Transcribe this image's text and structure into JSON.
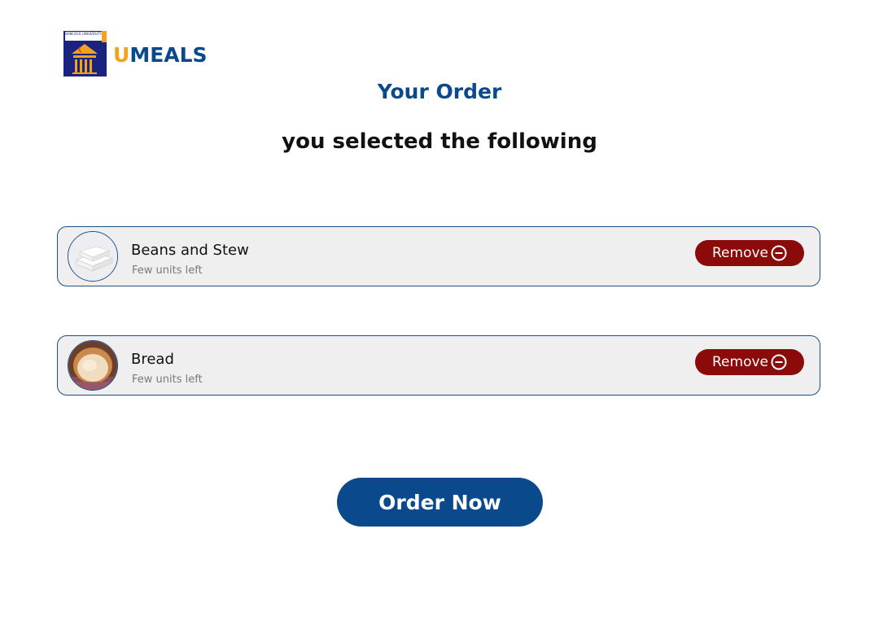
{
  "header": {
    "logo": {
      "icon": "babcock-university-crest-icon",
      "text": "BABCOCK UNIVERSITY"
    },
    "brand_prefix": "U",
    "brand_rest": "MEALS"
  },
  "page": {
    "title": "Your Order",
    "subtitle": "you selected the following"
  },
  "items": [
    {
      "name": "Beans and Stew",
      "stock": "Few units left",
      "image": "food-pack-image",
      "remove_label": "Remove",
      "remove_icon": "minus-circle-icon"
    },
    {
      "name": "Bread",
      "stock": "Few units left",
      "image": "bread-loaf-image",
      "remove_label": "Remove",
      "remove_icon": "minus-circle-icon"
    }
  ],
  "actions": {
    "order_label": "Order Now"
  },
  "colors": {
    "primary": "#0a4a8c",
    "accent": "#f2a31b",
    "danger": "#8b0a0a",
    "card_bg": "#efefef"
  }
}
